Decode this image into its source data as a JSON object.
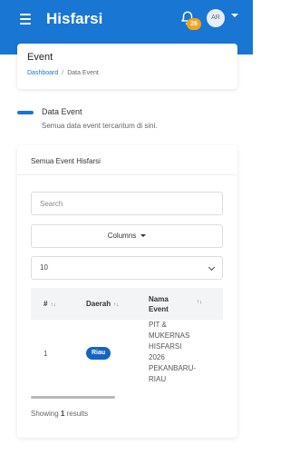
{
  "topbar": {
    "brand": "Hisfarsi",
    "notification_count": "26",
    "avatar_initials": "AR",
    "color": "#1976d2"
  },
  "header": {
    "title": "Event",
    "breadcrumb": [
      "Dashboard",
      "Data Event"
    ]
  },
  "section": {
    "title": "Data Event",
    "description": "Semua data event tercantum di sini."
  },
  "card": {
    "title": "Semua Event Hisfarsi",
    "search_placeholder": "Search",
    "columns_label": "Columns",
    "page_length": "10",
    "table": {
      "columns": [
        "#",
        "Daerah",
        "Nama Event"
      ],
      "rows": [
        {
          "number": "1",
          "region": "Riau",
          "event_name": "PIT & MUKERNAS HISFARSI 2026 PEKANBARU-RIAU"
        }
      ]
    },
    "results_prefix": "Showing",
    "results_count": "1",
    "results_suffix": "results"
  }
}
